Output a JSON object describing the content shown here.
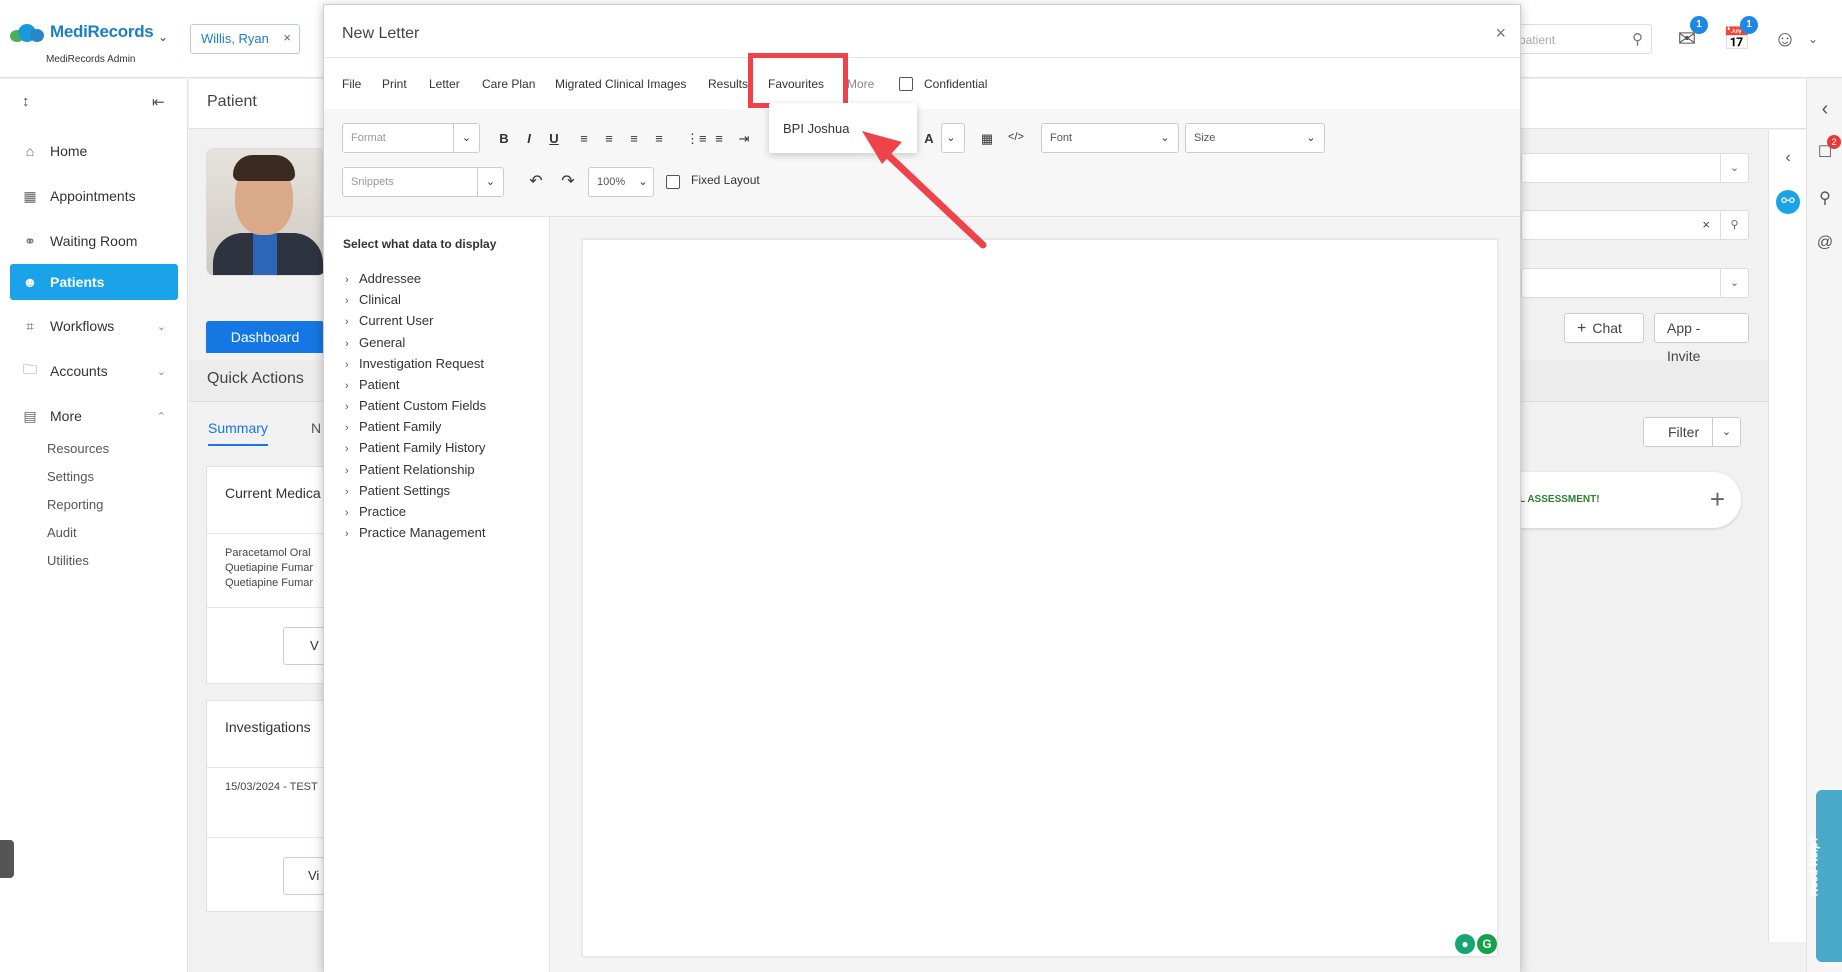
{
  "app": {
    "brand": "MediRecords",
    "subtitle": "MediRecords Admin",
    "patient_chip": "Willis, Ryan",
    "search_placeholder": "patient",
    "mail_badge": "1",
    "tasks_badge": "1"
  },
  "sidebar": {
    "items": [
      {
        "label": "Home",
        "icon": "home-icon"
      },
      {
        "label": "Appointments",
        "icon": "calendar-icon"
      },
      {
        "label": "Waiting Room",
        "icon": "waiting-room-icon"
      },
      {
        "label": "Patients",
        "icon": "patients-icon",
        "active": true
      },
      {
        "label": "Workflows",
        "icon": "workflows-icon"
      },
      {
        "label": "Accounts",
        "icon": "folder-icon"
      },
      {
        "label": "More",
        "icon": "more-icon"
      }
    ],
    "more_items": [
      "Resources",
      "Settings",
      "Reporting",
      "Audit",
      "Utilities"
    ]
  },
  "background": {
    "page_title": "Patient",
    "dashboard_button": "Dashboard",
    "quick_actions": "Quick Actions",
    "tabs": [
      "Summary",
      "N"
    ],
    "medications_card": {
      "title": "Current Medica",
      "lines": [
        "Paracetamol Oral",
        "Quetiapine Fumar",
        "Quetiapine Fumar"
      ],
      "button": "V"
    },
    "investigations_card": {
      "title": "Investigations",
      "lines": [
        "15/03/2024 - TEST"
      ],
      "button": "Vi"
    },
    "chat_button": "Chat",
    "app_invite_button": "App - Invite",
    "filter_button": "Filter",
    "assessment_text": "L ASSESSMENT!",
    "notification_badge": "2",
    "need_help": "Need Help?"
  },
  "modal": {
    "title": "New Letter",
    "menu": [
      "File",
      "Print",
      "Letter",
      "Care Plan",
      "Migrated Clinical Images",
      "Results",
      "Favourites",
      "More"
    ],
    "confidential_label": "Confidential",
    "format_placeholder": "Format",
    "snippets_placeholder": "Snippets",
    "zoom": "100%",
    "fixed_layout_label": "Fixed Layout",
    "font_select": "Font",
    "size_select": "Size",
    "favourites_dropdown": [
      "BPI Joshua"
    ],
    "left_pane_title": "Select what data to display",
    "tree": [
      "Addressee",
      "Clinical",
      "Current User",
      "General",
      "Investigation Request",
      "Patient",
      "Patient Custom Fields",
      "Patient Family",
      "Patient Family History",
      "Patient Relationship",
      "Patient Settings",
      "Practice",
      "Practice Management"
    ]
  },
  "colors": {
    "accent": "#1aa3e8",
    "highlight": "#f0424b",
    "brand_green": "#4caf50"
  }
}
